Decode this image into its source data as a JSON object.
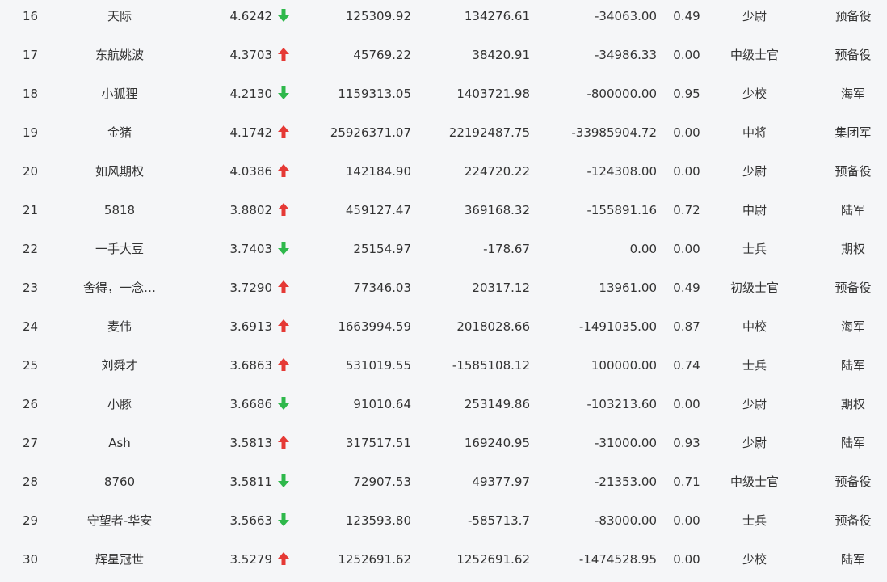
{
  "colors": {
    "up": "#e53935",
    "down": "#2eb84b",
    "text": "#333333",
    "background": "#f5f6f8"
  },
  "rows": [
    {
      "rank": "16",
      "name": "天际",
      "score": "4.6242",
      "trend": "down",
      "v1": "125309.92",
      "v2": "134276.61",
      "v3": "-34063.00",
      "ratio": "0.49",
      "level": "少尉",
      "group": "预备役"
    },
    {
      "rank": "17",
      "name": "东航姚波",
      "score": "4.3703",
      "trend": "up",
      "v1": "45769.22",
      "v2": "38420.91",
      "v3": "-34986.33",
      "ratio": "0.00",
      "level": "中级士官",
      "group": "预备役"
    },
    {
      "rank": "18",
      "name": "小狐狸",
      "score": "4.2130",
      "trend": "down",
      "v1": "1159313.05",
      "v2": "1403721.98",
      "v3": "-800000.00",
      "ratio": "0.95",
      "level": "少校",
      "group": "海军"
    },
    {
      "rank": "19",
      "name": "金猪",
      "score": "4.1742",
      "trend": "up",
      "v1": "25926371.07",
      "v2": "22192487.75",
      "v3": "-33985904.72",
      "ratio": "0.00",
      "level": "中将",
      "group": "集团军"
    },
    {
      "rank": "20",
      "name": "如风期权",
      "score": "4.0386",
      "trend": "up",
      "v1": "142184.90",
      "v2": "224720.22",
      "v3": "-124308.00",
      "ratio": "0.00",
      "level": "少尉",
      "group": "预备役"
    },
    {
      "rank": "21",
      "name": "5818",
      "score": "3.8802",
      "trend": "up",
      "v1": "459127.47",
      "v2": "369168.32",
      "v3": "-155891.16",
      "ratio": "0.72",
      "level": "中尉",
      "group": "陆军"
    },
    {
      "rank": "22",
      "name": "一手大豆",
      "score": "3.7403",
      "trend": "down",
      "v1": "25154.97",
      "v2": "-178.67",
      "v3": "0.00",
      "ratio": "0.00",
      "level": "士兵",
      "group": "期权"
    },
    {
      "rank": "23",
      "name": "舍得，一念…",
      "score": "3.7290",
      "trend": "up",
      "v1": "77346.03",
      "v2": "20317.12",
      "v3": "13961.00",
      "ratio": "0.49",
      "level": "初级士官",
      "group": "预备役"
    },
    {
      "rank": "24",
      "name": "麦伟",
      "score": "3.6913",
      "trend": "up",
      "v1": "1663994.59",
      "v2": "2018028.66",
      "v3": "-1491035.00",
      "ratio": "0.87",
      "level": "中校",
      "group": "海军"
    },
    {
      "rank": "25",
      "name": "刘舜才",
      "score": "3.6863",
      "trend": "up",
      "v1": "531019.55",
      "v2": "-1585108.12",
      "v3": "100000.00",
      "ratio": "0.74",
      "level": "士兵",
      "group": "陆军"
    },
    {
      "rank": "26",
      "name": "小豚",
      "score": "3.6686",
      "trend": "down",
      "v1": "91010.64",
      "v2": "253149.86",
      "v3": "-103213.60",
      "ratio": "0.00",
      "level": "少尉",
      "group": "期权"
    },
    {
      "rank": "27",
      "name": "Ash",
      "score": "3.5813",
      "trend": "up",
      "v1": "317517.51",
      "v2": "169240.95",
      "v3": "-31000.00",
      "ratio": "0.93",
      "level": "少尉",
      "group": "陆军"
    },
    {
      "rank": "28",
      "name": "8760",
      "score": "3.5811",
      "trend": "down",
      "v1": "72907.53",
      "v2": "49377.97",
      "v3": "-21353.00",
      "ratio": "0.71",
      "level": "中级士官",
      "group": "预备役"
    },
    {
      "rank": "29",
      "name": "守望者-华安",
      "score": "3.5663",
      "trend": "down",
      "v1": "123593.80",
      "v2": "-585713.7",
      "v3": "-83000.00",
      "ratio": "0.00",
      "level": "士兵",
      "group": "预备役"
    },
    {
      "rank": "30",
      "name": "辉星冠世",
      "score": "3.5279",
      "trend": "up",
      "v1": "1252691.62",
      "v2": "1252691.62",
      "v3": "-1474528.95",
      "ratio": "0.00",
      "level": "少校",
      "group": "陆军"
    }
  ]
}
